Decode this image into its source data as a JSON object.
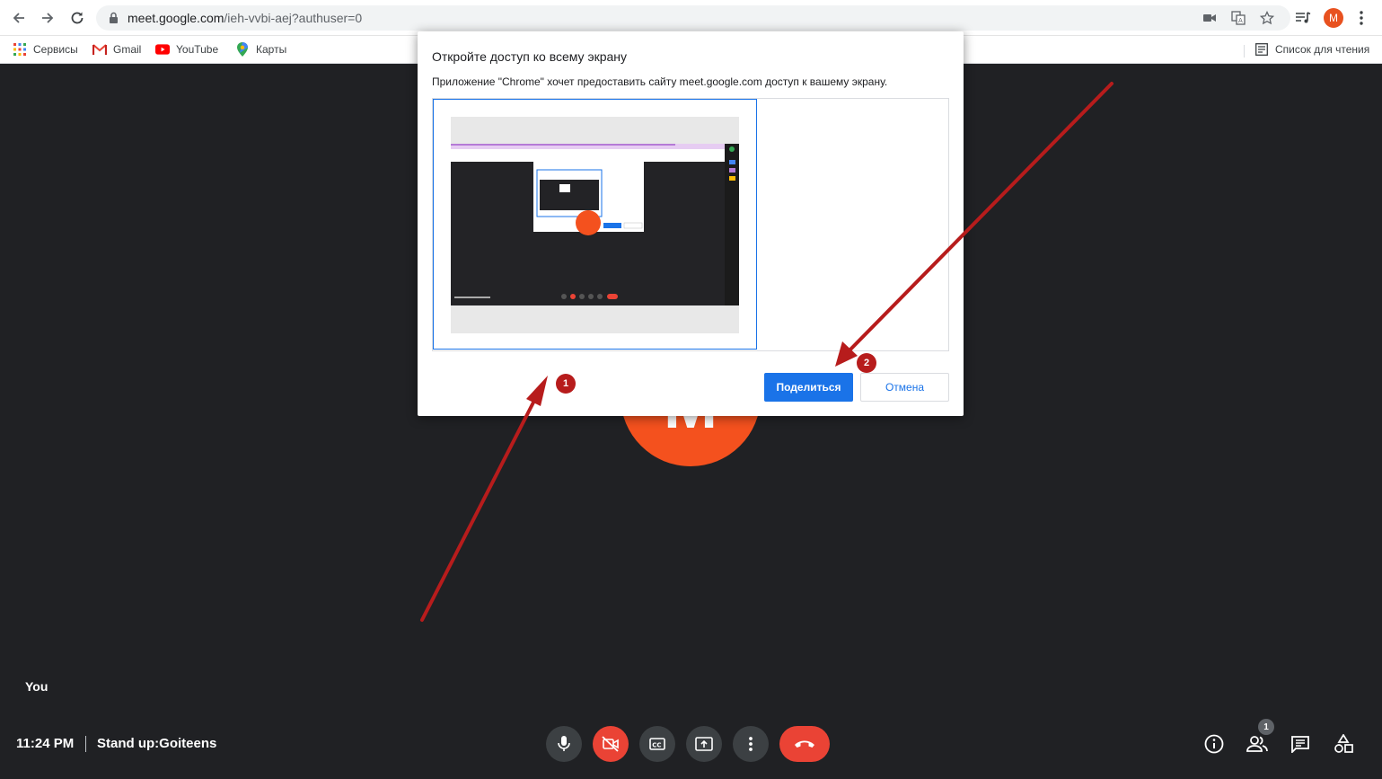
{
  "browser": {
    "url_host": "meet.google.com",
    "url_path": "/ieh-vvbi-aej?authuser=0",
    "avatar_letter": "M",
    "bookmarks": [
      {
        "label": "Сервисы",
        "icon": "apps-grid-icon"
      },
      {
        "label": "Gmail",
        "icon": "gmail-icon"
      },
      {
        "label": "YouTube",
        "icon": "youtube-icon"
      },
      {
        "label": "Карты",
        "icon": "maps-icon"
      }
    ],
    "reading_list": "Список для чтения"
  },
  "dialog": {
    "title": "Откройте доступ ко всему экрану",
    "description": "Приложение \"Chrome\" хочет предоставить сайту meet.google.com доступ к вашему экрану.",
    "share_label": "Поделиться",
    "cancel_label": "Отмена"
  },
  "meet": {
    "avatar_letter": "M",
    "you_label": "You",
    "time": "11:24 PM",
    "meeting_name": "Stand up:Goiteens",
    "participants_count": "1"
  },
  "annotations": {
    "step1": "1",
    "step2": "2"
  },
  "colors": {
    "stage_bg": "#202124",
    "accent": "#1a73e8",
    "danger": "#ea4335",
    "avatar": "#f4511e",
    "annotation": "#b71c1c"
  }
}
